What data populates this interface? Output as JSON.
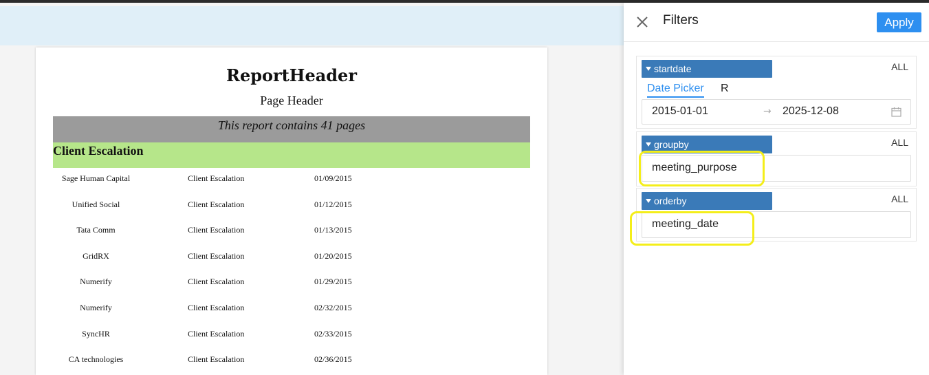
{
  "report": {
    "report_header": "ReportHeader",
    "page_header": "Page Header",
    "pages_note": "This report contains 41 pages",
    "group_label": "Client Escalation",
    "rows": [
      {
        "client": "Sage Human Capital",
        "purpose": "Client Escalation",
        "date": "01/09/2015"
      },
      {
        "client": "Unified Social",
        "purpose": "Client Escalation",
        "date": "01/12/2015"
      },
      {
        "client": "Tata Comm",
        "purpose": "Client Escalation",
        "date": "01/13/2015"
      },
      {
        "client": "GridRX",
        "purpose": "Client Escalation",
        "date": "01/20/2015"
      },
      {
        "client": "Numerify",
        "purpose": "Client Escalation",
        "date": "01/29/2015"
      },
      {
        "client": "Numerify",
        "purpose": "Client Escalation",
        "date": "02/32/2015"
      },
      {
        "client": "SyncHR",
        "purpose": "Client Escalation",
        "date": "02/33/2015"
      },
      {
        "client": "CA technologies",
        "purpose": "Client Escalation",
        "date": "02/36/2015"
      }
    ]
  },
  "filters": {
    "title": "Filters",
    "apply_label": "Apply",
    "close_icon": "close-icon",
    "startdate": {
      "name": "startdate",
      "all_label": "ALL",
      "tabs": [
        "Date Picker",
        "R"
      ],
      "active_tab": "Date Picker",
      "from": "2015-01-01",
      "to": "2025-12-08",
      "separator": "→",
      "calendar_icon": "calendar-icon"
    },
    "groupby": {
      "name": "groupby",
      "all_label": "ALL",
      "value": "meeting_purpose"
    },
    "orderby": {
      "name": "orderby",
      "all_label": "ALL",
      "value": "meeting_date"
    }
  },
  "colors": {
    "accent": "#2d8ff0",
    "filter_header": "#3a7ab8",
    "group_band": "#b6e68a",
    "pages_band": "#9b9b9b",
    "highlight": "#f4ee1a",
    "top_band": "#e0eff8"
  }
}
